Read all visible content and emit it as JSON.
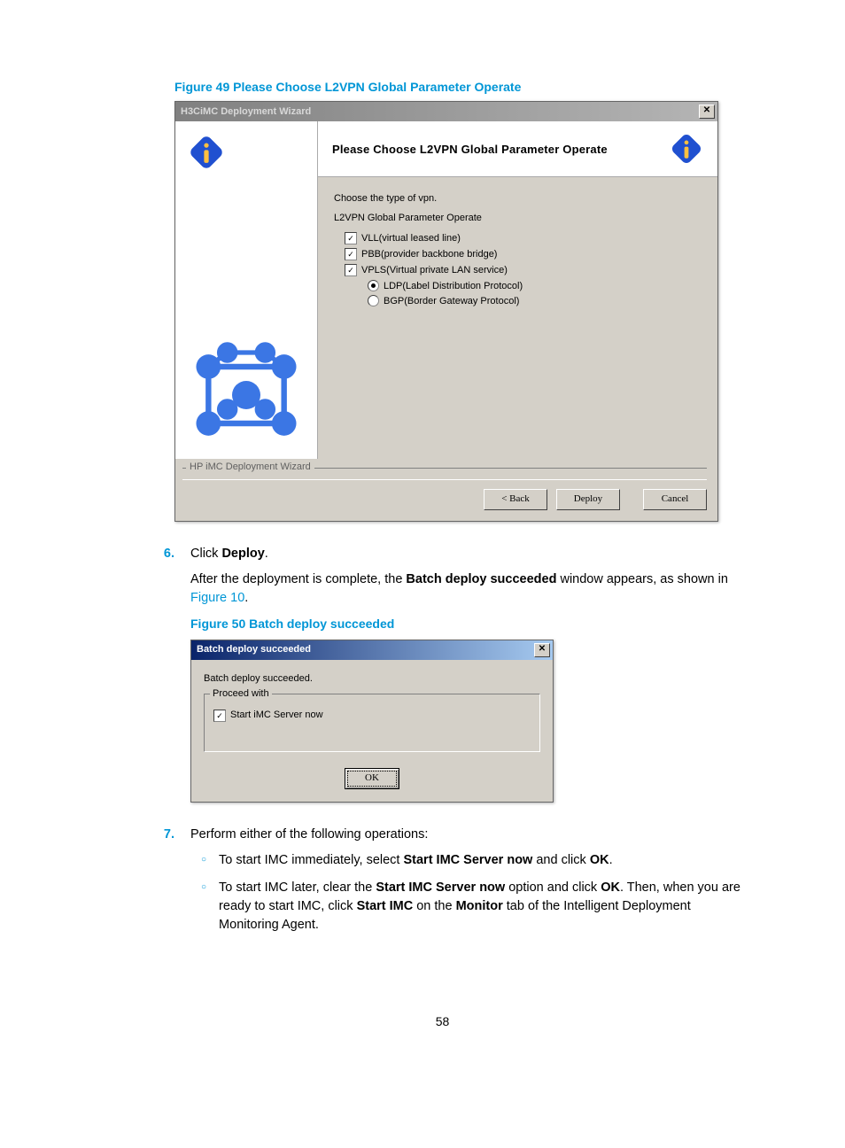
{
  "figure49_caption": "Figure 49 Please Choose L2VPN Global Parameter Operate",
  "dialog1": {
    "title": "H3CiMC Deployment Wizard",
    "header": "Please Choose L2VPN Global Parameter Operate",
    "instruction": "Choose the type of vpn.",
    "group_label": "L2VPN Global Parameter Operate",
    "options": {
      "vll": "VLL(virtual leased line)",
      "pbb": "PBB(provider backbone bridge)",
      "vpls": "VPLS(Virtual private LAN service)",
      "ldp": "LDP(Label Distribution Protocol)",
      "bgp": "BGP(Border Gateway Protocol)"
    },
    "footer_label": "HP iMC Deployment Wizard",
    "buttons": {
      "back": "< Back",
      "deploy": "Deploy",
      "cancel": "Cancel"
    }
  },
  "step6": {
    "num": "6.",
    "line1_pre": "Click ",
    "line1_bold": "Deploy",
    "line1_post": ".",
    "line2_pre": "After the deployment is complete, the ",
    "line2_bold": "Batch deploy succeeded",
    "line2_post": " window appears, as shown in ",
    "line2_link": "Figure 10",
    "line2_end": "."
  },
  "figure50_caption": "Figure 50 Batch deploy succeeded",
  "dialog2": {
    "title": "Batch deploy succeeded",
    "message": "Batch deploy succeeded.",
    "group": "Proceed with",
    "checkbox": "Start iMC Server now",
    "ok": "OK"
  },
  "step7": {
    "num": "7.",
    "intro": "Perform either of the following operations:",
    "item1_pre": "To start IMC immediately, select ",
    "item1_b1": "Start IMC Server now",
    "item1_mid": " and click ",
    "item1_b2": "OK",
    "item1_end": ".",
    "item2_pre": "To start IMC later, clear the ",
    "item2_b1": "Start IMC Server now",
    "item2_mid1": " option and click ",
    "item2_b2": "OK",
    "item2_mid2": ". Then, when you are ready to start IMC, click ",
    "item2_b3": "Start IMC",
    "item2_mid3": " on the ",
    "item2_b4": "Monitor",
    "item2_end": " tab of the Intelligent Deployment Monitoring Agent."
  },
  "page_number": "58"
}
